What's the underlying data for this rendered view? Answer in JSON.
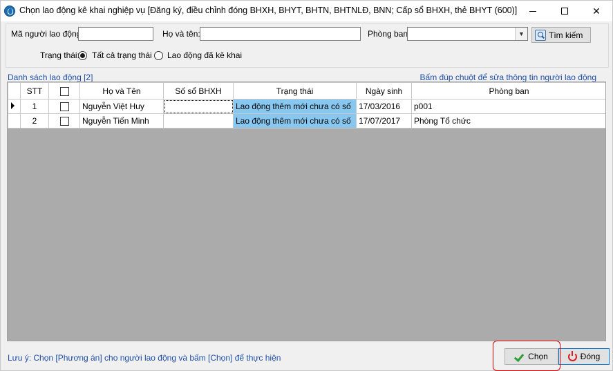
{
  "window": {
    "title": "Chọn lao động kê khai nghiệp vụ [Đăng ký, điều chỉnh đóng BHXH, BHYT, BHTN, BHTNLĐ, BNN; Cấp sổ BHXH, thẻ BHYT (600)]",
    "icons": {
      "minimize": "minimize-icon",
      "maximize": "maximize-icon",
      "close": "close-icon"
    },
    "close_glyph": "✕"
  },
  "filters": {
    "employee_code_label": "Mã người lao động:",
    "employee_code_value": "",
    "full_name_label": "Họ và tên:",
    "full_name_value": "",
    "department_label": "Phòng ban:",
    "department_value": "",
    "search_button": "Tìm kiếm",
    "status_label": "Trạng thái:",
    "status_options": [
      {
        "label": "Tất cả trạng thái",
        "selected": true
      },
      {
        "label": "Lao động đã kê khai",
        "selected": false
      }
    ]
  },
  "list": {
    "title": "Danh sách lao động [2]",
    "hint": "Bấm đúp chuột để sửa thông tin người lao động",
    "columns": [
      "STT",
      "",
      "Họ và Tên",
      "Số sổ BHXH",
      "Trạng thái",
      "Ngày sinh",
      "Phòng ban"
    ],
    "rows": [
      {
        "stt": "1",
        "checked": false,
        "name": "Nguyễn Việt Huy",
        "bhxh": "",
        "status": "Lao động thêm mới chưa có số",
        "dob": "17/03/2016",
        "department": "p001",
        "current": true
      },
      {
        "stt": "2",
        "checked": false,
        "name": "Nguyễn Tiến Minh",
        "bhxh": "",
        "status": "Lao động thêm mới chưa có số",
        "dob": "17/07/2017",
        "department": "Phòng Tổ chức",
        "current": false
      }
    ]
  },
  "footer": {
    "note": "Lưu ý: Chọn [Phương án] cho người lao động và bấm [Chọn] để thực hiện",
    "select_button": "Chọn",
    "close_button": "Đóng"
  },
  "colors": {
    "status_cell": "#87c7f0",
    "link_text": "#1f4fa6",
    "annotation": "#e00000"
  }
}
